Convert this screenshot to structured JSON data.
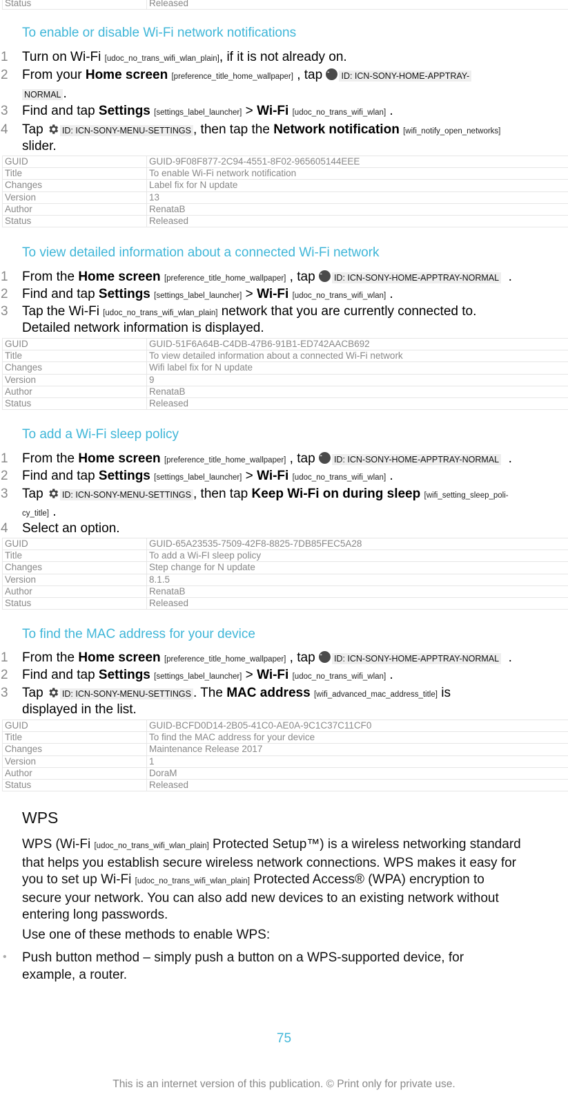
{
  "top_table_tail": {
    "key": "Status",
    "value": "Released"
  },
  "sections": [
    {
      "heading": "To enable or disable Wi-Fi network notifications",
      "steps": [
        {
          "num": "1",
          "parts": [
            "Turn on Wi-Fi",
            "[udoc_no_trans_wifi_wlan_plain]",
            ", if it is not already on."
          ]
        },
        {
          "num": "2",
          "parts": [
            "From your",
            "Home screen",
            "[preference_title_home_wallpaper]",
            ", tap",
            "ID: ICN-SONY-HOME-APPTRAY-",
            "NORMAL",
            "."
          ]
        },
        {
          "num": "3",
          "parts": [
            "Find and tap",
            "Settings",
            "[settings_label_launcher]",
            ">",
            "Wi-Fi",
            "[udoc_no_trans_wifi_wlan]",
            "."
          ]
        },
        {
          "num": "4",
          "parts": [
            "Tap",
            "ID: ICN-SONY-MENU-SETTINGS",
            ", then tap the",
            "Network notification",
            "[wifi_notify_open_networks]",
            "slider."
          ]
        }
      ],
      "meta": [
        {
          "key": "GUID",
          "value": "GUID-9F08F877-2C94-4551-8F02-965605144EEE"
        },
        {
          "key": "Title",
          "value": "To enable Wi-Fi network notification"
        },
        {
          "key": "Changes",
          "value": "Label fix for N update"
        },
        {
          "key": "Version",
          "value": "13"
        },
        {
          "key": "Author",
          "value": "RenataB"
        },
        {
          "key": "Status",
          "value": "Released"
        }
      ]
    },
    {
      "heading": "To view detailed information about a connected Wi-Fi network",
      "steps": [
        {
          "num": "1",
          "parts": [
            "From the",
            "Home screen",
            "[preference_title_home_wallpaper]",
            ", tap",
            "ID: ICN-SONY-HOME-APPTRAY-NORMAL",
            "."
          ]
        },
        {
          "num": "2",
          "parts": [
            "Find and tap",
            "Settings",
            "[settings_label_launcher]",
            ">",
            "Wi-Fi",
            "[udoc_no_trans_wifi_wlan]",
            "."
          ]
        },
        {
          "num": "3",
          "parts": [
            "Tap the Wi-Fi",
            "[udoc_no_trans_wifi_wlan_plain]",
            "network that you are currently connected to.",
            "Detailed network information is displayed."
          ]
        }
      ],
      "meta": [
        {
          "key": "GUID",
          "value": "GUID-51F6A64B-C4DB-47B6-91B1-ED742AACB692"
        },
        {
          "key": "Title",
          "value": "To view detailed information about a connected Wi-Fi network"
        },
        {
          "key": "Changes",
          "value": "Wifi label fix for N update"
        },
        {
          "key": "Version",
          "value": "9"
        },
        {
          "key": "Author",
          "value": "RenataB"
        },
        {
          "key": "Status",
          "value": "Released"
        }
      ]
    },
    {
      "heading": "To add a Wi-Fi sleep policy",
      "steps": [
        {
          "num": "1",
          "parts": [
            "From the",
            "Home screen",
            "[preference_title_home_wallpaper]",
            ", tap",
            "ID: ICN-SONY-HOME-APPTRAY-NORMAL",
            "."
          ]
        },
        {
          "num": "2",
          "parts": [
            "Find and tap",
            "Settings",
            "[settings_label_launcher]",
            ">",
            "Wi-Fi",
            "[udoc_no_trans_wifi_wlan]",
            "."
          ]
        },
        {
          "num": "3",
          "parts": [
            "Tap",
            "ID: ICN-SONY-MENU-SETTINGS",
            ", then tap",
            "Keep Wi-Fi on during sleep",
            "[wifi_setting_sleep_poli-",
            "cy_title]",
            "."
          ]
        },
        {
          "num": "4",
          "parts": [
            "Select an option."
          ]
        }
      ],
      "meta": [
        {
          "key": "GUID",
          "value": "GUID-65A23535-7509-42F8-8825-7DB85FEC5A28"
        },
        {
          "key": "Title",
          "value": "To add a Wi-FI sleep policy"
        },
        {
          "key": "Changes",
          "value": "Step change for N update"
        },
        {
          "key": "Version",
          "value": "8.1.5"
        },
        {
          "key": "Author",
          "value": "RenataB"
        },
        {
          "key": "Status",
          "value": "Released"
        }
      ]
    },
    {
      "heading": "To find the MAC address for your device",
      "steps": [
        {
          "num": "1",
          "parts": [
            "From the",
            "Home screen",
            "[preference_title_home_wallpaper]",
            ", tap",
            "ID: ICN-SONY-HOME-APPTRAY-NORMAL",
            "."
          ]
        },
        {
          "num": "2",
          "parts": [
            "Find and tap",
            "Settings",
            "[settings_label_launcher]",
            ">",
            "Wi-Fi",
            "[udoc_no_trans_wifi_wlan]",
            "."
          ]
        },
        {
          "num": "3",
          "parts": [
            "Tap",
            "ID: ICN-SONY-MENU-SETTINGS",
            ". The",
            "MAC address",
            "[wifi_advanced_mac_address_title]",
            "is",
            "displayed in the list."
          ]
        }
      ],
      "meta": [
        {
          "key": "GUID",
          "value": "GUID-BCFD0D14-2B05-41C0-AE0A-9C1C37C11CF0"
        },
        {
          "key": "Title",
          "value": "To find the MAC address for your device"
        },
        {
          "key": "Changes",
          "value": "Maintenance Release 2017"
        },
        {
          "key": "Version",
          "value": "1"
        },
        {
          "key": "Author",
          "value": "DoraM"
        },
        {
          "key": "Status",
          "value": "Released"
        }
      ]
    }
  ],
  "wps": {
    "heading": "WPS",
    "p1": [
      "WPS (Wi-Fi",
      "[udoc_no_trans_wifi_wlan_plain]",
      "Protected Setup™) is a wireless networking standard",
      "that helps you establish secure wireless network connections. WPS makes it easy for",
      "you to set up Wi-Fi",
      "[udoc_no_trans_wifi_wlan_plain]",
      "Protected Access® (WPA) encryption to",
      "secure your network. You can also add new devices to an existing network without",
      "entering long passwords."
    ],
    "p2": "Use one of these methods to enable WPS:",
    "bullets": [
      {
        "line1": "Push button method – simply push a button on a WPS-supported device, for",
        "line2": "example, a router."
      }
    ]
  },
  "icons": {
    "apptray": "app-tray-icon",
    "settings": "gear-settings-icon"
  },
  "colors": {
    "heading": "#3fb6d8",
    "meta_text": "#888888",
    "meta_border": "#e6e6e6",
    "id_box": "#eeeeee"
  },
  "footer": {
    "page_number": "75",
    "notice": "This is an internet version of this publication. © Print only for private use."
  }
}
